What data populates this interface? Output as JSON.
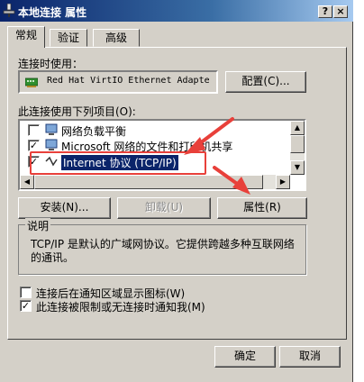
{
  "window": {
    "title": "本地连接 属性",
    "help_btn": "?",
    "close_btn": "×"
  },
  "tabs": [
    {
      "label": "常规",
      "active": true
    },
    {
      "label": "验证",
      "active": false
    },
    {
      "label": "高级",
      "active": false
    }
  ],
  "connect_using": {
    "label": "连接时使用：",
    "adapter": "Red Hat VirtIO Ethernet Adapte",
    "configure_btn": "配置(C)..."
  },
  "items_section": {
    "label": "此连接使用下列项目(O):",
    "items": [
      {
        "label": "网络负载平衡",
        "checked": false,
        "selected": false
      },
      {
        "label": "Microsoft 网络的文件和打印机共享",
        "checked": true,
        "selected": false
      },
      {
        "label": "Internet 协议 (TCP/IP)",
        "checked": true,
        "selected": true
      }
    ]
  },
  "buttons": {
    "install": "安装(N)...",
    "uninstall": "卸载(U)",
    "properties": "属性(R)"
  },
  "description": {
    "title": "说明",
    "text_line1": "TCP/IP 是默认的广域网协议。它提供跨越多种互联网络",
    "text_line2": "的通讯。"
  },
  "options": [
    {
      "label": "连接后在通知区域显示图标(W)",
      "checked": false
    },
    {
      "label": "此连接被限制或无连接时通知我(M)",
      "checked": true
    }
  ],
  "footer": {
    "ok": "确定",
    "cancel": "取消"
  },
  "colors": {
    "title_bar": "#0a246a",
    "annotation": "#e8403a",
    "selection": "#0a246a"
  }
}
